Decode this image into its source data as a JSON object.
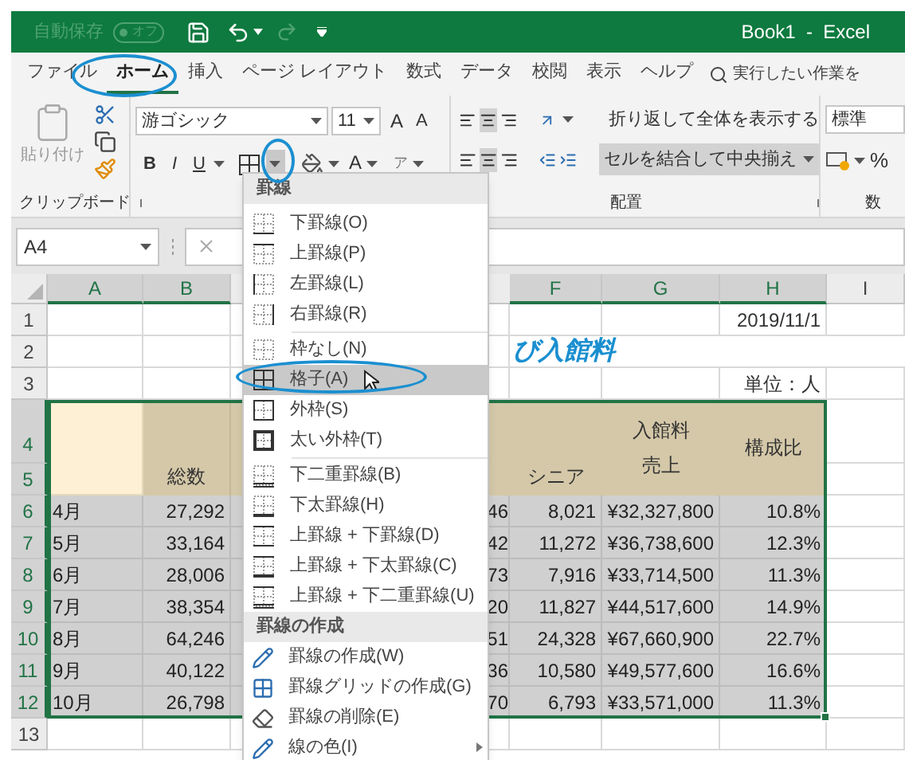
{
  "title_bar": {
    "autosave_label": "自動保存",
    "autosave_toggle": "オフ",
    "title": "Book1  -  Excel"
  },
  "ribbon_tabs": [
    {
      "label": "ファイル",
      "selected": false
    },
    {
      "label": "ホーム",
      "selected": true
    },
    {
      "label": "挿入",
      "selected": false
    },
    {
      "label": "ページ レイアウト",
      "selected": false
    },
    {
      "label": "数式",
      "selected": false
    },
    {
      "label": "データ",
      "selected": false
    },
    {
      "label": "校閲",
      "selected": false
    },
    {
      "label": "表示",
      "selected": false
    },
    {
      "label": "ヘルプ",
      "selected": false
    }
  ],
  "tell_me": "実行したい作業を",
  "ribbon": {
    "paste_label": "貼り付け",
    "clipboard_group": "クリップボード",
    "font_name": "游ゴシック",
    "font_size": "11",
    "grow_font": "A",
    "shrink_font": "A",
    "bold": "B",
    "italic": "I",
    "underline": "U",
    "font_color": "A",
    "phonetic": "ア",
    "wrap_text": "折り返して全体を表示する",
    "merge_center": "セルを結合して中央揃え",
    "alignment_group": "配置",
    "number_format": "標準",
    "percent": "%",
    "number_group": "数"
  },
  "name_box": "A4",
  "sheet": {
    "column_headers": [
      {
        "label": "A",
        "selected": true
      },
      {
        "label": "B",
        "selected": true
      },
      {
        "label": "F",
        "selected": true
      },
      {
        "label": "G",
        "selected": true
      },
      {
        "label": "H",
        "selected": true
      },
      {
        "label": "I",
        "selected": false
      }
    ],
    "row_numbers": [
      {
        "label": "1",
        "selected": false
      },
      {
        "label": "2",
        "selected": false
      },
      {
        "label": "3",
        "selected": false
      },
      {
        "label": "4",
        "selected": true
      },
      {
        "label": "5",
        "selected": true
      },
      {
        "label": "6",
        "selected": true
      },
      {
        "label": "7",
        "selected": true
      },
      {
        "label": "8",
        "selected": true
      },
      {
        "label": "9",
        "selected": true
      },
      {
        "label": "10",
        "selected": true
      },
      {
        "label": "11",
        "selected": true
      },
      {
        "label": "12",
        "selected": true
      },
      {
        "label": "13",
        "selected": false
      }
    ],
    "date": "2019/11/1",
    "title_fragment": "び入館料",
    "unit": "単位：人",
    "header": {
      "total": "総数",
      "senior": "シニア",
      "sales_line1": "入館料",
      "sales_line2": "売上",
      "ratio": "構成比"
    },
    "data": [
      {
        "month": "4月",
        "total": "27,292",
        "column_e": "46",
        "senior": "8,021",
        "sales": "¥32,327,800",
        "ratio": "10.8%"
      },
      {
        "month": "5月",
        "total": "33,164",
        "column_e": "42",
        "senior": "11,272",
        "sales": "¥36,738,600",
        "ratio": "12.3%"
      },
      {
        "month": "6月",
        "total": "28,006",
        "column_e": "73",
        "senior": "7,916",
        "sales": "¥33,714,500",
        "ratio": "11.3%"
      },
      {
        "month": "7月",
        "total": "38,354",
        "column_e": "20",
        "senior": "11,827",
        "sales": "¥44,517,600",
        "ratio": "14.9%"
      },
      {
        "month": "8月",
        "total": "64,246",
        "column_e": "51",
        "senior": "24,328",
        "sales": "¥67,660,900",
        "ratio": "22.7%"
      },
      {
        "month": "9月",
        "total": "40,122",
        "column_e": "36",
        "senior": "10,580",
        "sales": "¥49,577,600",
        "ratio": "16.6%"
      },
      {
        "month": "10月",
        "total": "26,798",
        "column_e": "70",
        "senior": "6,793",
        "sales": "¥33,571,000",
        "ratio": "11.3%"
      }
    ]
  },
  "border_menu": {
    "sections": [
      {
        "heading": "罫線",
        "groups": [
          [
            {
              "label": "下罫線(O)",
              "kind": "bottom",
              "selected": false,
              "submenu": false
            },
            {
              "label": "上罫線(P)",
              "kind": "top",
              "selected": false,
              "submenu": false
            },
            {
              "label": "左罫線(L)",
              "kind": "left",
              "selected": false,
              "submenu": false
            },
            {
              "label": "右罫線(R)",
              "kind": "right",
              "selected": false,
              "submenu": false
            }
          ],
          [
            {
              "label": "枠なし(N)",
              "kind": "none",
              "selected": false,
              "submenu": false
            },
            {
              "label": "格子(A)",
              "kind": "all",
              "selected": true,
              "submenu": false
            },
            {
              "label": "外枠(S)",
              "kind": "outside",
              "selected": false,
              "submenu": false
            },
            {
              "label": "太い外枠(T)",
              "kind": "thick_outside",
              "selected": false,
              "submenu": false
            }
          ],
          [
            {
              "label": "下二重罫線(B)",
              "kind": "bottom_double",
              "selected": false,
              "submenu": false
            },
            {
              "label": "下太罫線(H)",
              "kind": "bottom_thick",
              "selected": false,
              "submenu": false
            },
            {
              "label": "上罫線 + 下罫線(D)",
              "kind": "top_bottom",
              "selected": false,
              "submenu": false
            },
            {
              "label": "上罫線 + 下太罫線(C)",
              "kind": "top_thick_bottom",
              "selected": false,
              "submenu": false
            },
            {
              "label": "上罫線 + 下二重罫線(U)",
              "kind": "top_double_bottom",
              "selected": false,
              "submenu": false
            }
          ]
        ]
      },
      {
        "heading": "罫線の作成",
        "groups": [
          [
            {
              "label": "罫線の作成(W)",
              "kind": "draw",
              "selected": false,
              "submenu": false
            },
            {
              "label": "罫線グリッドの作成(G)",
              "kind": "draw_grid",
              "selected": false,
              "submenu": false
            },
            {
              "label": "罫線の削除(E)",
              "kind": "erase",
              "selected": false,
              "submenu": false
            },
            {
              "label": "線の色(I)",
              "kind": "color",
              "selected": false,
              "submenu": true
            }
          ]
        ]
      }
    ]
  }
}
